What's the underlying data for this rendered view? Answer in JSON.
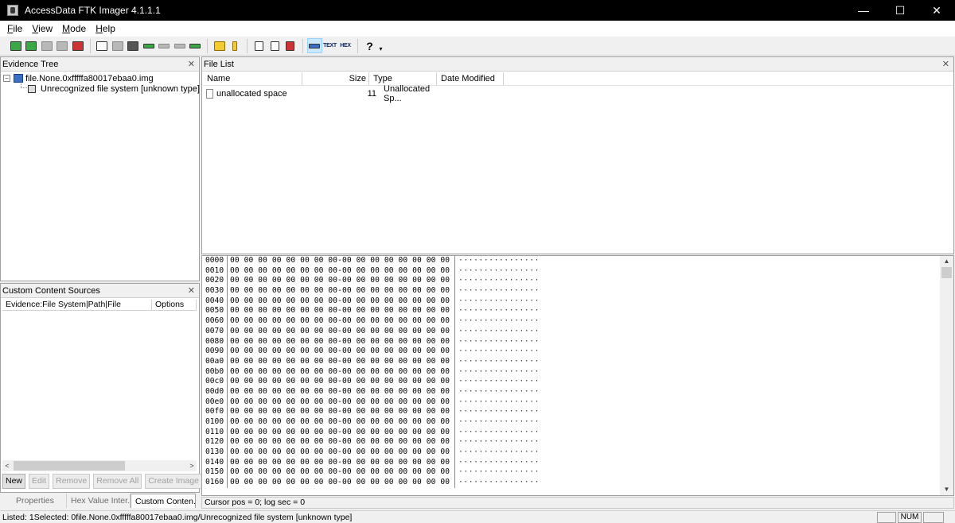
{
  "window": {
    "title": "AccessData FTK Imager 4.1.1.1",
    "minimize": "—",
    "maximize": "☐",
    "close": "✕"
  },
  "menu": [
    {
      "label": "F",
      "rest": "ile"
    },
    {
      "label": "V",
      "rest": "iew"
    },
    {
      "label": "M",
      "rest": "ode"
    },
    {
      "label": "H",
      "rest": "elp"
    }
  ],
  "toolbar": {
    "text_view_label": "TEXT",
    "hex_view_label": "HEX",
    "help_glyph": "?",
    "dropdown_glyph": "▾"
  },
  "evidence_tree": {
    "title": "Evidence Tree",
    "close": "✕",
    "expander": "−",
    "root": "file.None.0xfffffa80017ebaa0.img",
    "child": "Unrecognized file system [unknown type]"
  },
  "custom_content": {
    "title": "Custom Content Sources",
    "close": "✕",
    "columns": [
      "Evidence:File System|Path|File",
      "Options"
    ],
    "scroll_left": "<",
    "scroll_right": ">",
    "buttons": {
      "new": "New",
      "edit": "Edit",
      "remove": "Remove",
      "remove_all": "Remove All",
      "create_image": "Create Image"
    }
  },
  "bottom_tabs": [
    "Properties",
    "Hex Value Inter...",
    "Custom Conten..."
  ],
  "file_list": {
    "title": "File List",
    "close": "✕",
    "columns": [
      "Name",
      "Size",
      "Type",
      "Date Modified"
    ],
    "rows": [
      {
        "name": "unallocated space",
        "size": "11",
        "type": "Unallocated Sp...",
        "date": ""
      }
    ]
  },
  "hex_view": {
    "offsets": [
      "0000",
      "0010",
      "0020",
      "0030",
      "0040",
      "0050",
      "0060",
      "0070",
      "0080",
      "0090",
      "00a0",
      "00b0",
      "00c0",
      "00d0",
      "00e0",
      "00f0",
      "0100",
      "0110",
      "0120",
      "0130",
      "0140",
      "0150",
      "0160"
    ],
    "bytes": "00 00 00 00 00 00 00 00-00 00 00 00 00 00 00 00",
    "ascii": "················",
    "scroll_up": "▲",
    "scroll_down": "▼"
  },
  "cursor_status": "Cursor pos = 0; log sec = 0",
  "status_bar": {
    "text": "Listed: 1Selected: 0file.None.0xfffffa80017ebaa0.img/Unrecognized file system [unknown type]",
    "cells": [
      "",
      "NUM",
      ""
    ]
  }
}
